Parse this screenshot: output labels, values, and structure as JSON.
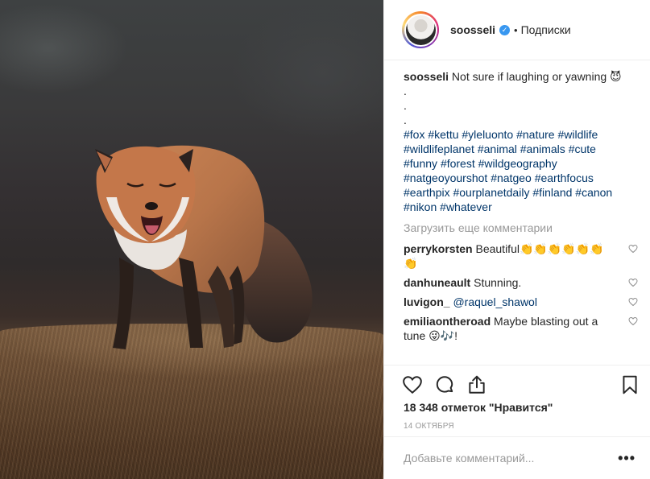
{
  "post": {
    "photo_alt": "",
    "author": {
      "username": "soosseli",
      "verified": true,
      "follow_status": "Подписки",
      "separator": "•"
    },
    "caption": {
      "username": "soosseli",
      "text": "Not sure if laughing or yawning 😈",
      "dots": [
        ".",
        ".",
        "."
      ],
      "hashtags": [
        "#fox",
        "#kettu",
        "#yleluonto",
        "#nature",
        "#wildlife",
        "#wildlifeplanet",
        "#animal",
        "#animals",
        "#cute",
        "#funny",
        "#forest",
        "#wildgeography",
        "#natgeoyourshot",
        "#natgeo",
        "#earthfocus",
        "#earthpix",
        "#ourplanetdaily",
        "#finland",
        "#canon",
        "#nikon",
        "#whatever"
      ]
    },
    "load_more_label": "Загрузить еще комментарии",
    "comments": [
      {
        "username": "perrykorsten",
        "text": "Beautiful👏👏👏👏👏👏👏",
        "mention": ""
      },
      {
        "username": "danhuneault",
        "text": "Stunning.",
        "mention": ""
      },
      {
        "username": "luvigon_",
        "text": "",
        "mention": "@raquel_shawol"
      },
      {
        "username": "emiliaontheroad",
        "text": "Maybe blasting out a tune 😜🎶!",
        "mention": ""
      }
    ],
    "likes_label": "18 348 отметок \"Нравится\"",
    "date_label": "14 ОКТЯБРЯ",
    "add_comment_placeholder": "Добавьте комментарий...",
    "more_options": "•••",
    "icons": {
      "like": "heart-icon",
      "comment": "comment-bubble-icon",
      "share": "share-icon",
      "save": "bookmark-icon",
      "comment_like": "small-heart-icon",
      "verified": "verified-badge-icon"
    },
    "colors": {
      "link": "#003569",
      "verified": "#3897f0",
      "muted": "#999999",
      "text": "#262626"
    }
  }
}
